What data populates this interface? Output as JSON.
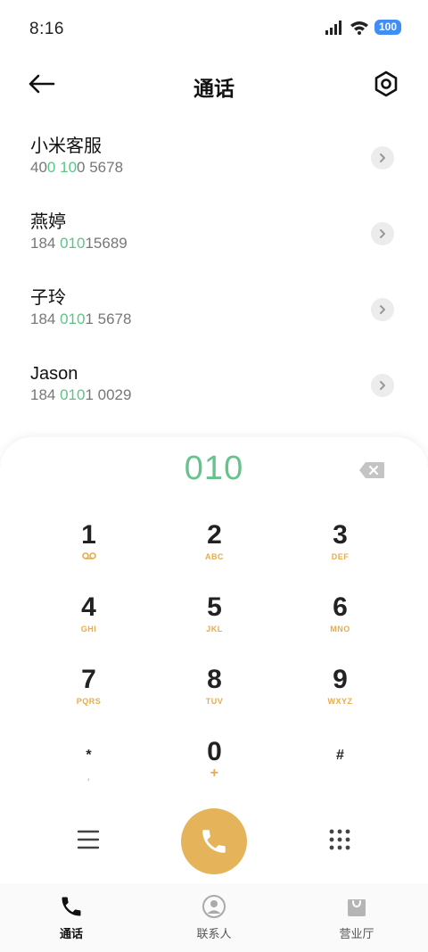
{
  "status_bar": {
    "time": "8:16",
    "battery": "100",
    "signal_icon": "signal-icon",
    "wifi_icon": "wifi-icon"
  },
  "header": {
    "title": "通话",
    "back_icon": "back-arrow-icon",
    "settings_icon": "settings-icon"
  },
  "contacts": [
    {
      "name": "小米客服",
      "number_parts": [
        "40",
        "0",
        " ",
        "10",
        "0 5678"
      ]
    },
    {
      "name": "燕婷",
      "number_parts": [
        "184 ",
        "010",
        "15689"
      ]
    },
    {
      "name": "子玲",
      "number_parts": [
        "184 ",
        "010",
        "1 5678"
      ]
    },
    {
      "name": "Jason",
      "number_parts": [
        "184 ",
        "010",
        "1 0029"
      ]
    }
  ],
  "dialer": {
    "input_value": "010",
    "keys": [
      {
        "digit": "1",
        "letters": ""
      },
      {
        "digit": "2",
        "letters": "ABC"
      },
      {
        "digit": "3",
        "letters": "DEF"
      },
      {
        "digit": "4",
        "letters": "GHI"
      },
      {
        "digit": "5",
        "letters": "JKL"
      },
      {
        "digit": "6",
        "letters": "MNO"
      },
      {
        "digit": "7",
        "letters": "PQRS"
      },
      {
        "digit": "8",
        "letters": "TUV"
      },
      {
        "digit": "9",
        "letters": "WXYZ"
      },
      {
        "digit": "*",
        "letters": ","
      },
      {
        "digit": "0",
        "letters": "+"
      },
      {
        "digit": "#",
        "letters": ""
      }
    ]
  },
  "bottom_nav": {
    "items": [
      {
        "label": "通话",
        "icon": "phone-icon",
        "active": true
      },
      {
        "label": "联系人",
        "icon": "contacts-icon",
        "active": false
      },
      {
        "label": "营业厅",
        "icon": "store-icon",
        "active": false
      }
    ]
  },
  "colors": {
    "accent_green": "#5cc487",
    "call_button": "#e5b35a",
    "key_letters": "#e8ac4a",
    "battery": "#3f8ef5"
  }
}
